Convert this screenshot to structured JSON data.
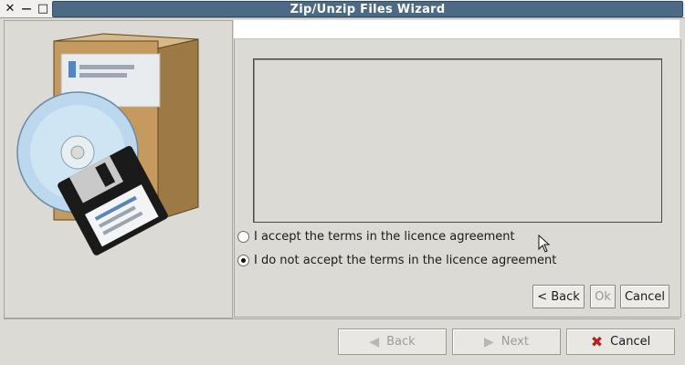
{
  "window": {
    "title": "Zip/Unzip Files Wizard",
    "close_glyph": "✕",
    "minimize_glyph": "—",
    "maximize_glyph": "□"
  },
  "licence": {
    "text": "",
    "options": [
      {
        "label": "I accept the terms in the licence agreement",
        "selected": false
      },
      {
        "label": "I do not accept the terms in the licence agreement",
        "selected": true
      }
    ]
  },
  "inner_buttons": {
    "back": "< Back",
    "ok": "Ok",
    "cancel": "Cancel"
  },
  "footer_buttons": {
    "back": "Back",
    "next": "Next",
    "cancel": "Cancel",
    "back_icon": "arrow-left-icon",
    "next_icon": "arrow-right-icon",
    "cancel_icon": "x-icon"
  },
  "colors": {
    "title_bar": "#4c6a86",
    "window_bg": "#dcdad5"
  }
}
